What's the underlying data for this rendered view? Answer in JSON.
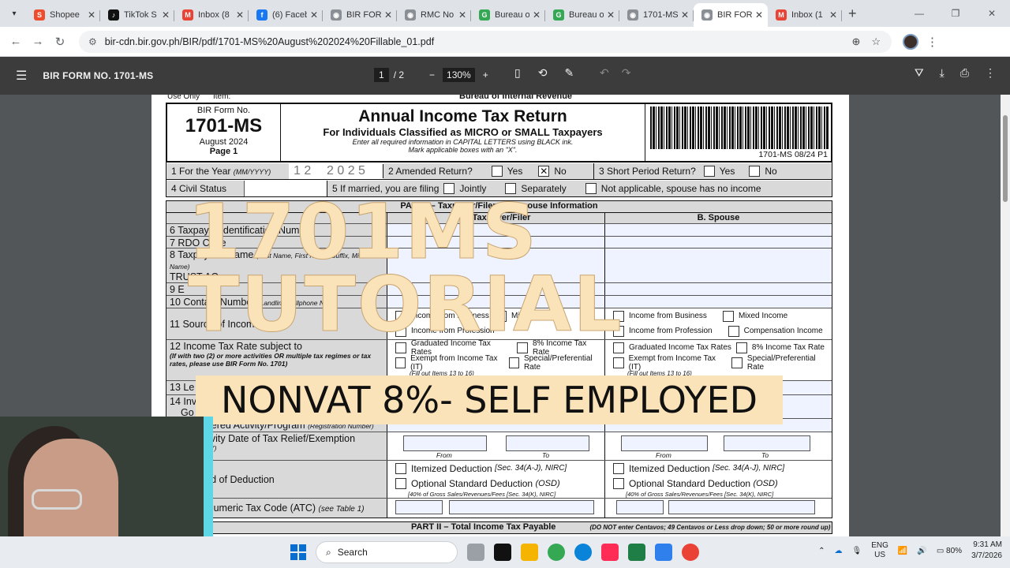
{
  "tabs": [
    {
      "title": "Shopee",
      "color": "#ee4d2d",
      "glyph": "S"
    },
    {
      "title": "TikTok S",
      "color": "#111111",
      "glyph": "♪"
    },
    {
      "title": "Inbox (8",
      "color": "#ea4335",
      "glyph": "M"
    },
    {
      "title": "(6) Faceb",
      "color": "#1877f2",
      "glyph": "f"
    },
    {
      "title": "BIR FOR",
      "color": "#8a8f95",
      "glyph": "◉"
    },
    {
      "title": "RMC No",
      "color": "#8a8f95",
      "glyph": "◉"
    },
    {
      "title": "Bureau o",
      "color": "#34a853",
      "glyph": "G"
    },
    {
      "title": "Bureau o",
      "color": "#34a853",
      "glyph": "G"
    },
    {
      "title": "1701-MS",
      "color": "#8a8f95",
      "glyph": "◉"
    },
    {
      "title": "BIR FOR",
      "color": "#8a8f95",
      "glyph": "◉"
    },
    {
      "title": "Inbox (1",
      "color": "#ea4335",
      "glyph": "M"
    }
  ],
  "browser": {
    "url": "bir-cdn.bir.gov.ph/BIR/pdf/1701-MS%20August%202024%20Fillable_01.pdf"
  },
  "pdf": {
    "title": "BIR FORM NO. 1701-MS",
    "page": "1",
    "total": "/ 2",
    "zoom": "130%"
  },
  "form": {
    "agency": "Bureau of Internal Revenue",
    "top_left": "Use Only",
    "top_item": "Item:",
    "form_no_label": "BIR Form No.",
    "form_no": "1701-MS",
    "edition": "August 2024",
    "page": "Page 1",
    "title": "Annual Income Tax Return",
    "subtitle": "For Individuals Classified as MICRO or SMALL Taxpayers",
    "inst1": "Enter all required information in CAPITAL LETTERS using BLACK ink.",
    "inst2": "Mark applicable boxes with an \"X\".",
    "code": "1701-MS 08/24 P1",
    "year_label": "1 For the Year",
    "year_fmt": "(MM/YYYY)",
    "month": "1 2",
    "year": "2 0 2 5",
    "amended": "2 Amended Return?",
    "yes": "Yes",
    "no": "No",
    "short": "3 Short Period Return?",
    "civil": "4 Civil Status",
    "married": "5 If married, you are filing",
    "jointly": "Jointly",
    "separately": "Separately",
    "na": "Not applicable, spouse has no income",
    "part1": "PART I – Taxpayer/Filer and Spouse Information",
    "col_a": "A. Taxpayer/Filer",
    "col_b": "B.   Spouse",
    "r6": "6 Taxpayer Identification Number",
    "r7": "7 RDO Code",
    "r8": "8 Taxpayer's Name",
    "r8sub": "(Last Name, First Name, Suffix, Middle Name)",
    "r8val": "TRUST AO",
    "r9": "9 E",
    "r10": "10 Contact Number",
    "r10sub": "(Landline/Cellphone No.)",
    "r11": "11 Source of Income",
    "opt_business": "Income from Business",
    "opt_mixed": "Mixed Income",
    "opt_profession": "Income from Profession",
    "opt_comp": "Compensation Income",
    "r12": "12 Income Tax Rate subject to",
    "r12sub": "(If with two (2) or more activities OR multiple tax regimes or tax rates, please use BIR Form No. 1701)",
    "opt_graduated": "Graduated Income Tax Rates",
    "opt_8": "8% Income Tax Rate",
    "opt_exempt": "Exempt from Income Tax (IT)",
    "opt_special": "Special/Preferential Rate",
    "fill": "(Fill out Items 13 to 16)",
    "r13": "13 Le",
    "r14": "14 Inv",
    "r14b": "Go",
    "r15": "15 Registered Activity/Program",
    "r15sub": "(Registration Number)",
    "r16": "16 Effectivity Date of Tax Relief/Exemption",
    "r16sub": "(MM/DD/YYYY)",
    "from": "From",
    "to": "To",
    "r17": "17 Method of Deduction",
    "itemized": "Itemized Deduction",
    "itemized_ref": "[Sec. 34(A-J), NIRC]",
    "osd": "Optional Standard Deduction",
    "osd_abbr": "(OSD)",
    "osd_sub": "[40% of Gross Sales/Revenues/Fees [Sec. 34(K), NIRC]",
    "r18": "18 Alphanumeric Tax Code (ATC)",
    "r18sub": "(see Table 1)",
    "part2": "PART II – Total Income Tax Payable",
    "part2sub": "(DO NOT enter Centavos; 49 Centavos or Less drop down; 50 or more round up)"
  },
  "overlay": {
    "line1": "1701MS",
    "line2": "TUTORIAL",
    "banner": "NONVAT 8%- SELF EMPLOYED"
  },
  "taskbar": {
    "search": "Search",
    "lang1": "ENG",
    "lang2": "US",
    "battery": "80%",
    "time": "9:31 AM",
    "date": "3/7/2026"
  }
}
